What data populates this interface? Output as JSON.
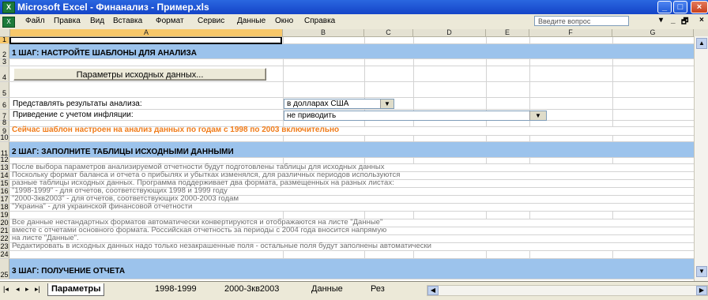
{
  "window": {
    "title": "Microsoft Excel - Финанализ - Пример.xls",
    "app_icon": "X",
    "controls": {
      "minimize": "_",
      "maximize": "□",
      "close": "×"
    }
  },
  "menu": {
    "items": [
      "Файл",
      "Правка",
      "Вид",
      "Вставка",
      "Формат",
      "Сервис",
      "Данные",
      "Окно",
      "Справка"
    ],
    "ask_question_placeholder": "Введите вопрос",
    "right_controls": [
      "▾",
      "_",
      "🗗",
      "×"
    ]
  },
  "columns": [
    "A",
    "B",
    "C",
    "D",
    "E",
    "F",
    "G"
  ],
  "rows": {
    "r1": {
      "num": "1"
    },
    "r2": {
      "num": "2",
      "text": "1 ШАГ: НАСТРОЙТЕ ШАБЛОНЫ ДЛЯ АНАЛИЗА"
    },
    "r3": {
      "num": "3"
    },
    "r4": {
      "num": "4",
      "button": "Параметры исходных данных..."
    },
    "r5": {
      "num": "5"
    },
    "r6": {
      "num": "6",
      "label": "Представлять результаты анализа:",
      "select": "в долларах США"
    },
    "r7": {
      "num": "7",
      "label": "Приведение с учетом инфляции:",
      "select": "не приводить"
    },
    "r8": {
      "num": "8"
    },
    "r9": {
      "num": "9",
      "text": "Сейчас шаблон настроен на анализ данных по годам с 1998 по 2003 включительно"
    },
    "r10": {
      "num": "10"
    },
    "r11": {
      "num": "11",
      "text": "2 ШАГ: ЗАПОЛНИТЕ ТАБЛИЦЫ ИСХОДНЫМИ ДАННЫМИ"
    },
    "r12": {
      "num": "12"
    },
    "r13": {
      "num": "13",
      "text": "После выбора параметров анализируемой отчетности будут подготовлены таблицы для исходных данных"
    },
    "r14": {
      "num": "14",
      "text": "Поскольку формат баланса и отчета о прибылях и убытках изменялся, для различных периодов используются"
    },
    "r15": {
      "num": "15",
      "text": "разные таблицы исходных данных. Программа поддерживает два формата, размещенных на разных листах:"
    },
    "r16": {
      "num": "16",
      "text": "\"1998-1999\" - для отчетов, соответствующих 1998 и 1999 году"
    },
    "r17": {
      "num": "17",
      "text": "\"2000-3кв2003\" - для отчетов, соответствующих 2000-2003 годам"
    },
    "r18": {
      "num": "18",
      "text": "\"Украина\" - для украинской финансовой отчетности"
    },
    "r19": {
      "num": "19"
    },
    "r20": {
      "num": "20",
      "text": "Все данные нестандартных форматов автоматически конвертируются и отображаются на листе \"Данные\""
    },
    "r21": {
      "num": "21",
      "text": "вместе с отчетами основного формата. Российская отчетность за периоды с 2004 года вносится напрямую"
    },
    "r22": {
      "num": "22",
      "text": "на листе \"Данные\"."
    },
    "r23": {
      "num": "23",
      "text": "Редактировать в исходных данных надо только незакрашенные поля - остальные поля будут заполнены автоматически"
    },
    "r24": {
      "num": "24"
    },
    "r25": {
      "num": "25",
      "text": "3 ШАГ: ПОЛУЧЕНИЕ ОТЧЕТА"
    }
  },
  "sheet_tabs": {
    "nav": [
      "|◂",
      "◂",
      "▸",
      "▸|"
    ],
    "tabs": [
      "Параметры",
      "1998-1999",
      "2000-3кв2003",
      "Данные",
      "Рез"
    ]
  },
  "colors": {
    "band": "#9cc3ec",
    "orange_text": "#f07c1a",
    "gray_text": "#707070",
    "title_bar": "#1444c7"
  }
}
